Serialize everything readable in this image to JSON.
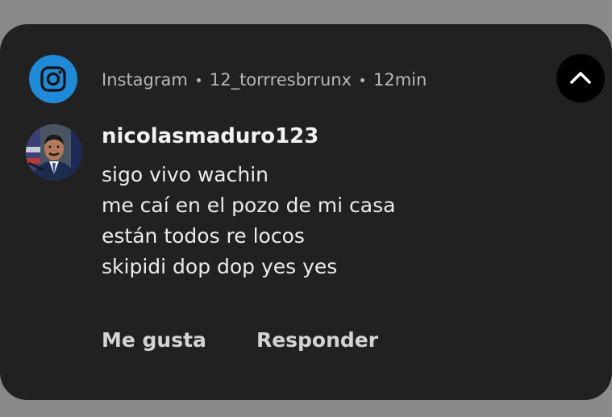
{
  "notification": {
    "app_name": "Instagram",
    "account": "12_torrresbrrunx",
    "time": "12min",
    "app_icon": "instagram-icon",
    "collapse_icon": "chevron-up-icon",
    "sender": "nicolasmaduro123",
    "message_lines": [
      "sigo vivo wachin",
      "me caí en el pozo de mi casa",
      "están todos re locos",
      "skipidi dop dop yes yes"
    ],
    "actions": {
      "like_label": "Me gusta",
      "reply_label": "Responder"
    }
  },
  "colors": {
    "background": "#8a8a8a",
    "card": "#212121",
    "app_icon_bg": "#1f8ad8",
    "collapse_button_bg": "#000000"
  }
}
